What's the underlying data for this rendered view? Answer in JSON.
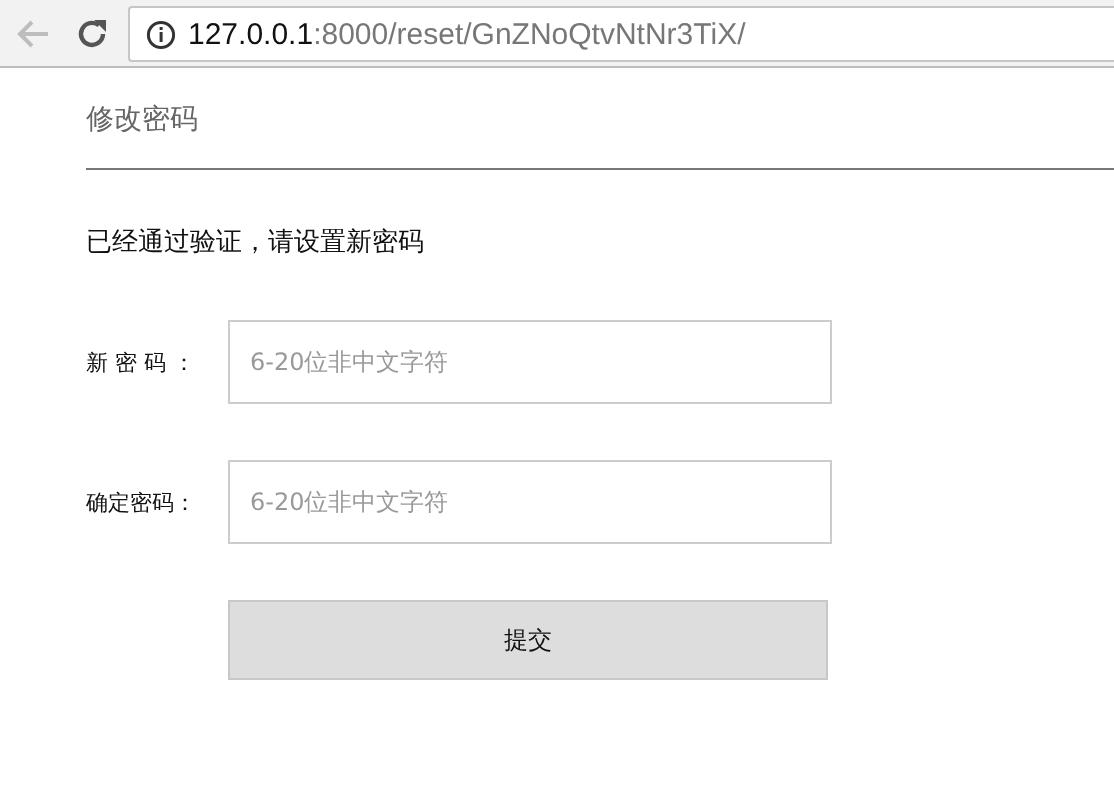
{
  "browser": {
    "url_host": "127.0.0.1",
    "url_path": ":8000/reset/GnZNoQtvNtNr3TiX/",
    "back_disabled": true
  },
  "page": {
    "title": "修改密码",
    "message": "已经通过验证，请设置新密码",
    "fields": [
      {
        "label": "新 密 码 ：",
        "placeholder": "6-20位非中文字符"
      },
      {
        "label": "确定密码：",
        "placeholder": "6-20位非中文字符"
      }
    ],
    "submit": "提交"
  }
}
